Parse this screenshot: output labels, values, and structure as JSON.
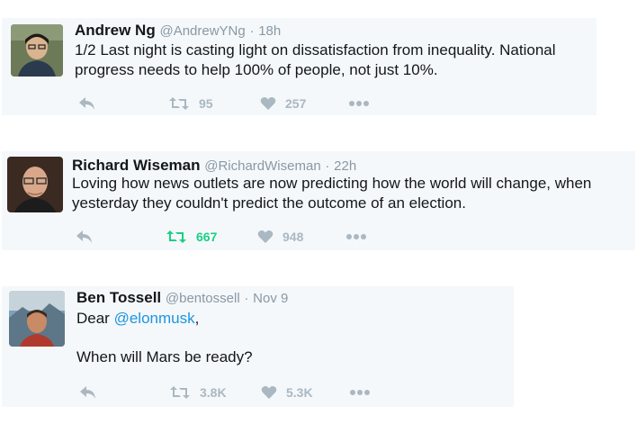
{
  "tweets": [
    {
      "name": "Andrew Ng",
      "handle": "@AndrewYNg",
      "dot": "·",
      "time": "18h",
      "text_lines": [
        "1/2 Last night is casting light on dissatisfaction from inequality. National",
        "progress needs to help 100% of people, not just 10%."
      ],
      "retweets": "95",
      "likes": "257",
      "retweeted": false
    },
    {
      "name": "Richard Wiseman",
      "handle": "@RichardWiseman",
      "dot": "·",
      "time": "22h",
      "text_lines": [
        "Loving how news outlets are now predicting how the world will change, when",
        "yesterday they couldn't predict the outcome of an election."
      ],
      "retweets": "667",
      "likes": "948",
      "retweeted": true
    },
    {
      "name": "Ben Tossell",
      "handle": "@bentossell",
      "dot": "·",
      "time": "Nov 9",
      "greeting": "Dear ",
      "mention": "@elonmusk",
      "greeting_end": ",",
      "question": "When will Mars be ready?",
      "retweets": "3.8K",
      "likes": "5.3K",
      "retweeted": false
    }
  ],
  "icons": {
    "reply": "reply-icon",
    "retweet": "retweet-icon",
    "like": "heart-icon",
    "more": "more-icon"
  },
  "colors": {
    "card_bg": "#f5f8fa",
    "name": "#14171a",
    "meta": "#8899a6",
    "icon": "#aab8c2",
    "retweet_active": "#19cf86",
    "link": "#1b95e0"
  }
}
